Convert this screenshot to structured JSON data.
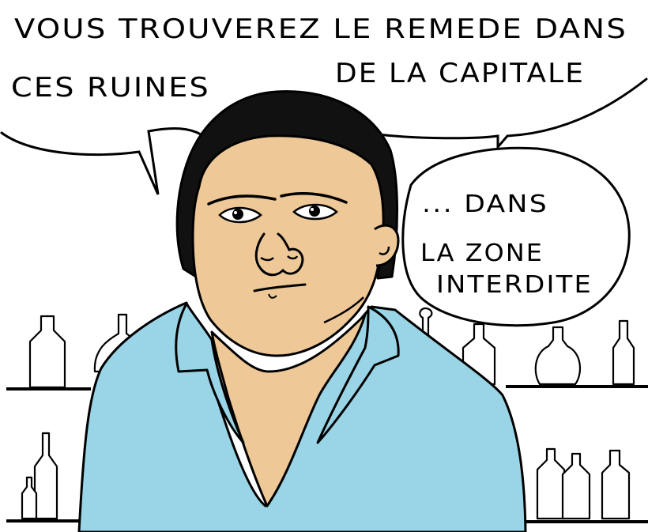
{
  "speech": {
    "main_line1": "VOUS TROUVEREZ LE REMEDE DANS",
    "main_line2a": "CES RUINES",
    "main_line2b": "DE LA CAPITALE",
    "bubble_line1": "... DANS",
    "bubble_line2": "LA ZONE",
    "bubble_line3": "INTERDITE"
  },
  "colors": {
    "skin": "#eec897",
    "shirt": "#99d5e6",
    "ink": "#000000",
    "background": "#ffffff"
  }
}
